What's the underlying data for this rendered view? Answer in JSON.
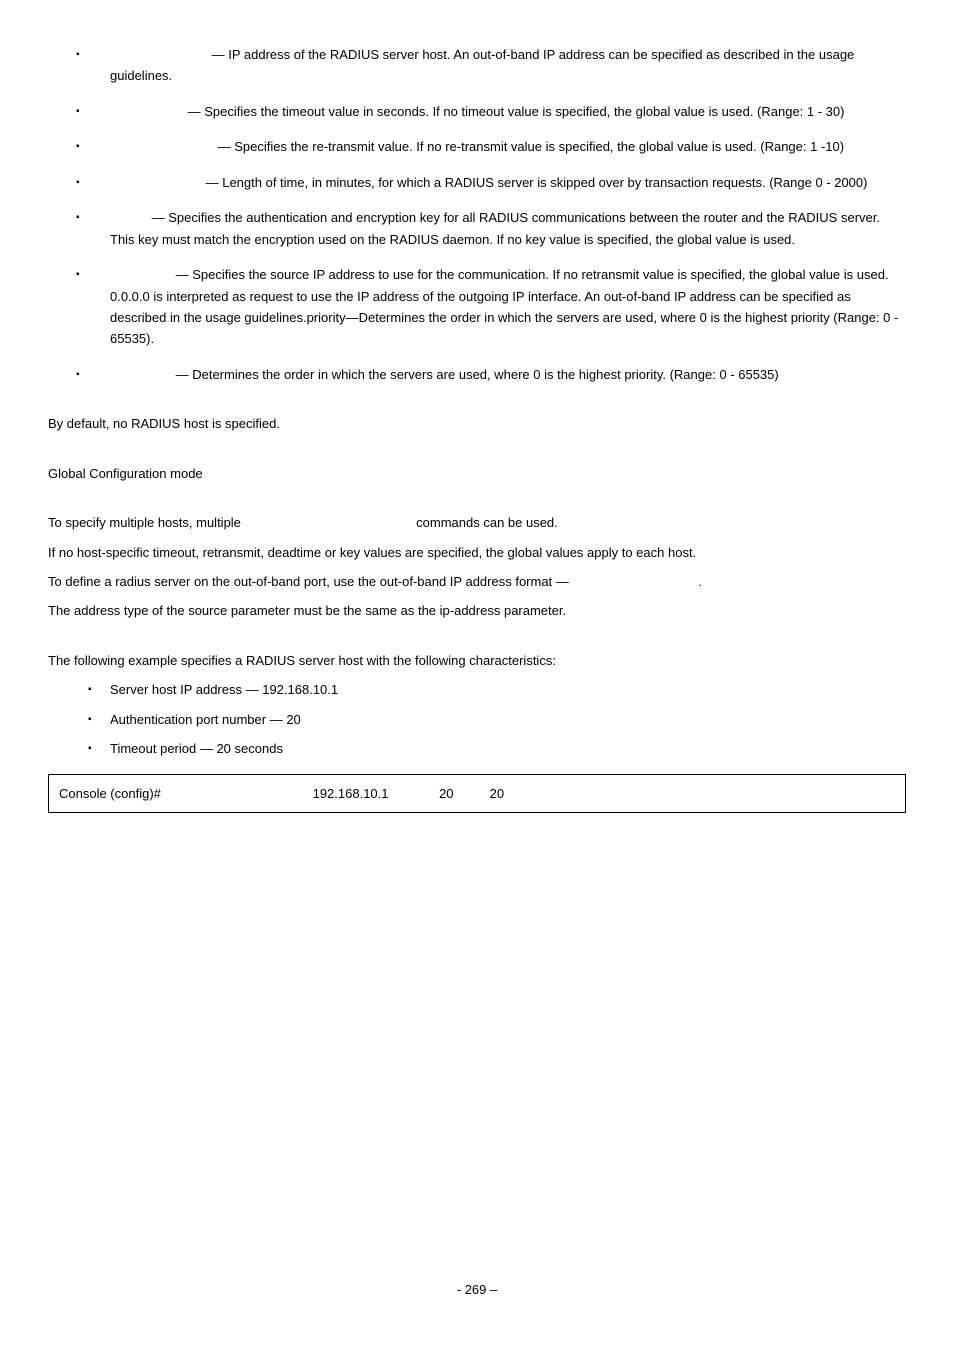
{
  "bullets_params": [
    {
      "name": "param-ip-address",
      "text": " — IP address of the RADIUS server host. An out-of-band IP address can be specified as described in the usage guidelines.",
      "pad": 98
    },
    {
      "name": "param-timeout",
      "text": " — Specifies the timeout value in seconds. If no timeout value is specified, the global value is used. (Range: 1 - 30)",
      "pad": 74
    },
    {
      "name": "param-retransmit",
      "text": " — Specifies the re-transmit value. If no re-transmit value is specified, the global value is used. (Range: 1 -10)",
      "pad": 104
    },
    {
      "name": "param-deadtime",
      "text": " — Length of time, in minutes, for which a RADIUS server is skipped over by transaction requests. (Range 0 - 2000)",
      "pad": 92
    },
    {
      "name": "param-key",
      "text": " — Specifies the authentication and encryption key for all RADIUS communications between the router and the RADIUS server. This key must match the encryption used on the RADIUS daemon. If no key value is specified, the global value is used.",
      "pad": 38
    },
    {
      "name": "param-source",
      "text": " — Specifies the source IP address to use for the communication. If no retransmit value is specified, the global value is used. 0.0.0.0 is interpreted as request to use the IP address of the outgoing IP interface. An out-of-band IP address can be specified as described in the usage guidelines.priority—Determines the order in which the servers are used, where 0 is the highest priority (Range: 0 - 65535).",
      "pad": 62
    },
    {
      "name": "param-priority",
      "text": " — Determines the order in which the servers are used, where 0 is the highest priority. (Range: 0 - 65535)",
      "pad": 62
    }
  ],
  "default_config": "By default, no RADIUS host is specified.",
  "command_mode": "Global Configuration mode",
  "user_guidelines": {
    "l1a": "To specify multiple hosts, multiple ",
    "l1b": " commands can be used.",
    "l2": "If no host-specific timeout, retransmit, deadtime or key values are specified, the global values apply to each host.",
    "l3a": "To define a radius server on the out-of-band port, use the out-of-band IP address format — ",
    "l3b": ".",
    "l4": "The address type of the source parameter must be the same as the ip-address parameter."
  },
  "example_intro": "The following example specifies a RADIUS server host with the following characteristics:",
  "example_bullets": [
    "Server host IP address — 192.168.10.1",
    "Authentication port number — 20",
    "Timeout period — 20 seconds"
  ],
  "console": {
    "prompt": "Console (config)# ",
    "cmd_indent1": "                                         ",
    "ip": "192.168.10.1",
    "cmd_indent2": "              ",
    "port": "20",
    "cmd_indent3": "          ",
    "timeout": "20"
  },
  "page_number": "- 269 –"
}
